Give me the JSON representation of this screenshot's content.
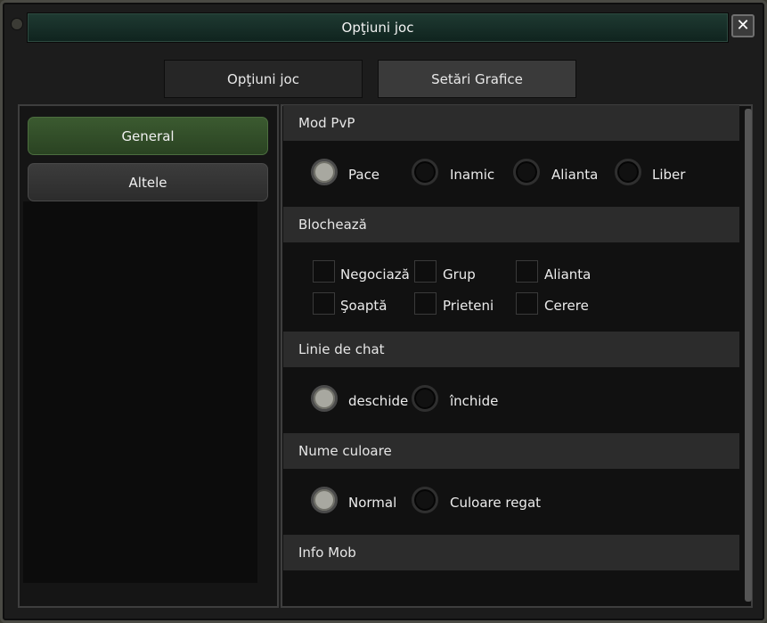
{
  "window": {
    "title": "Opţiuni joc",
    "close_icon": "close-icon"
  },
  "tabs": [
    {
      "label": "Opţiuni joc",
      "active": false
    },
    {
      "label": "Setări Grafice",
      "active": true
    }
  ],
  "sidebar": {
    "items": [
      {
        "label": "General",
        "active": true
      },
      {
        "label": "Altele",
        "active": false
      }
    ]
  },
  "sections": {
    "pvp": {
      "title": "Mod PvP",
      "options": [
        {
          "label": "Pace",
          "selected": true
        },
        {
          "label": "Inamic",
          "selected": false
        },
        {
          "label": "Alianta",
          "selected": false
        },
        {
          "label": "Liber",
          "selected": false
        }
      ]
    },
    "block": {
      "title": "Blochează",
      "options": [
        {
          "label": "Negociază",
          "checked": false
        },
        {
          "label": "Grup",
          "checked": false
        },
        {
          "label": "Alianta",
          "checked": false
        },
        {
          "label": "Şoaptă",
          "checked": false
        },
        {
          "label": "Prieteni",
          "checked": false
        },
        {
          "label": "Cerere",
          "checked": false
        }
      ]
    },
    "chat": {
      "title": "Linie de chat",
      "options": [
        {
          "label": "deschide",
          "selected": true
        },
        {
          "label": "închide",
          "selected": false
        }
      ]
    },
    "name_color": {
      "title": "Nume culoare",
      "options": [
        {
          "label": "Normal",
          "selected": true
        },
        {
          "label": "Culoare regat",
          "selected": false
        }
      ]
    },
    "mob": {
      "title": "Info Mob"
    }
  },
  "colors": {
    "accent_green": "#3b5a30",
    "titlebar": "#1f3a32",
    "panel": "#111111"
  }
}
